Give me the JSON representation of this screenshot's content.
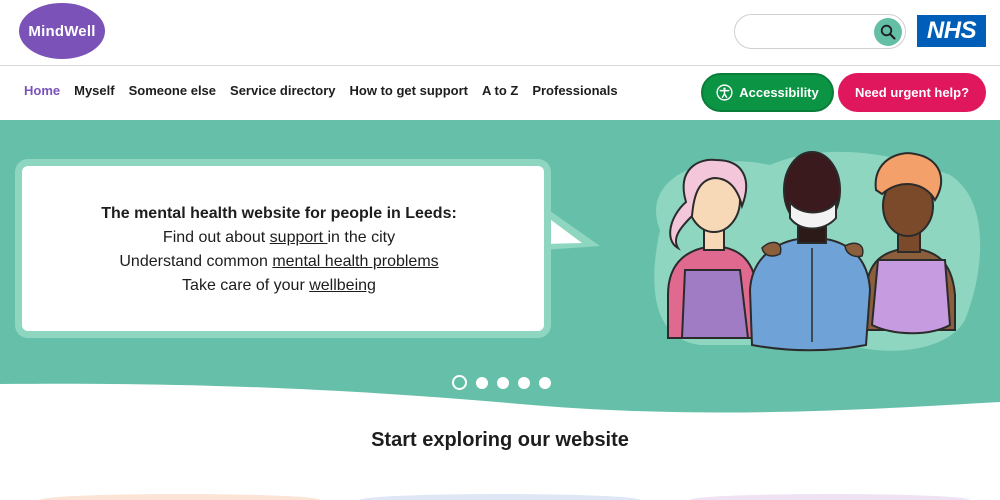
{
  "header": {
    "logo_text": "MindWell",
    "search_placeholder": "",
    "search_icon": "search-icon",
    "nhs_text": "NHS"
  },
  "nav": {
    "links": [
      {
        "label": "Home"
      },
      {
        "label": "Myself"
      },
      {
        "label": "Someone else"
      },
      {
        "label": "Service directory"
      },
      {
        "label": "How to get support"
      },
      {
        "label": "A to Z"
      },
      {
        "label": "Professionals"
      }
    ],
    "accessibility_label": "Accessibility",
    "urgent_label": "Need urgent help?"
  },
  "hero": {
    "lead": "The mental health website for people in Leeds:",
    "line1_prefix": "Find out about ",
    "line1_link": "support ",
    "line1_suffix": "in the city",
    "line2_prefix": "Understand common ",
    "line2_link": "mental health problems",
    "line3_prefix": "Take care of your ",
    "line3_link": "wellbeing",
    "slides_total": 5,
    "active_slide": 1
  },
  "colors": {
    "brand_purple": "#7a52b8",
    "hero_green": "#66c0a9",
    "accessibility_green": "#0b9444",
    "urgent_pink": "#e0175d",
    "nhs_blue": "#005eb8"
  },
  "sections": {
    "explore_title": "Start exploring our website"
  }
}
